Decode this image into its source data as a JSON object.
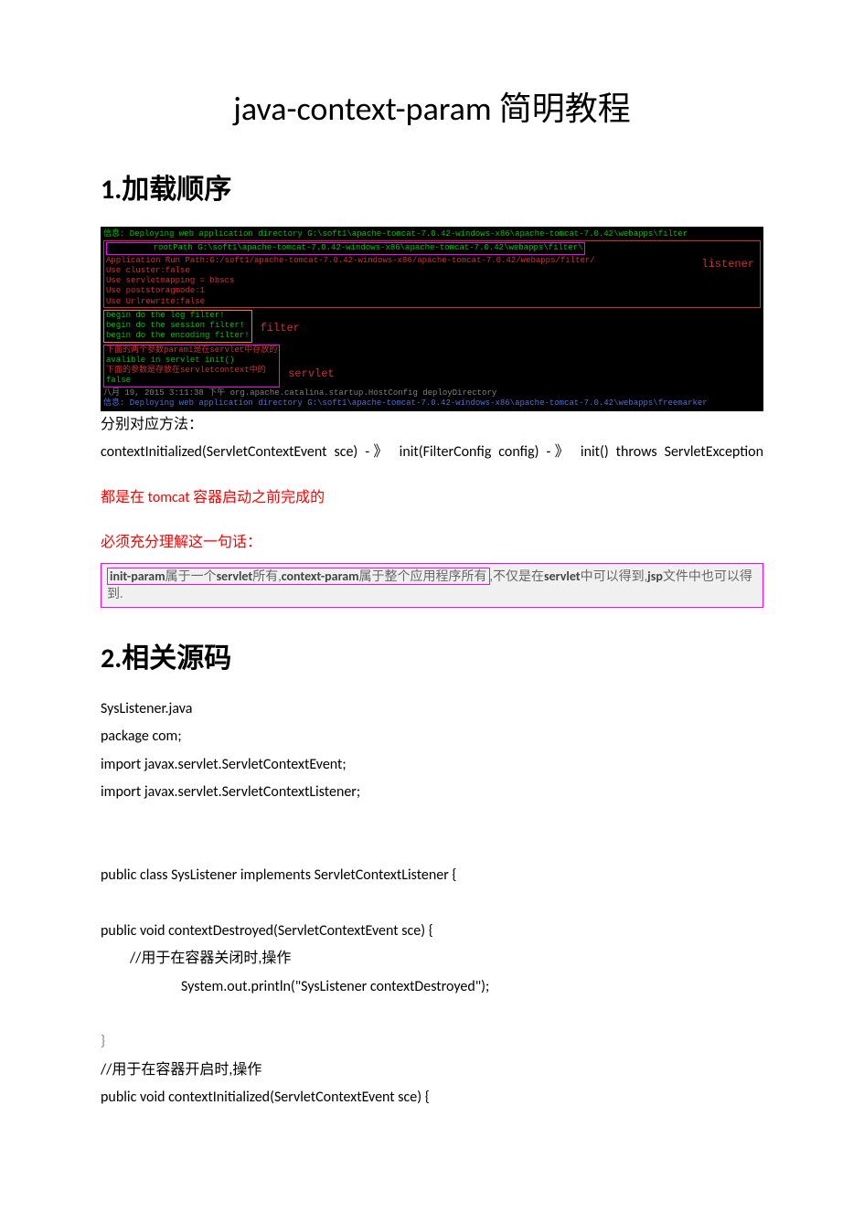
{
  "title": "java-context-param 简明教程",
  "section1": {
    "heading": "1.加载顺序",
    "console": {
      "line_deploy1": "信息: Deploying web application directory G:\\soft1\\apache-tomcat-7.0.42-windows-x86\\apache-tomcat-7.0.42\\webapps\\filter",
      "listener": {
        "l1": "         rootPath G:\\soft1\\apache-tomcat-7.0.42-windows-x86\\apache-tomcat-7.0.42\\webapps\\filter\\",
        "l2": "Application Run Path:G:/soft1/apache-tomcat-7.0.42-windows-x86/apache-tomcat-7.0.42/webapps/filter/",
        "l3": "Use cluster:false",
        "l4": "Use servletmapping = bbscs",
        "l5": "Use poststoragmode:1",
        "l6": "Use Urlrewrite:false",
        "label": "listener"
      },
      "filter": {
        "f1": "begin do the log filter!",
        "f2": "begin do the session filter!",
        "f3": "begin do the encoding filter!",
        "label": "filter"
      },
      "servlet": {
        "s1": "下面的两个参数param1是在servlet中存放的",
        "s2": "avalible in servlet init()",
        "s3": "下面的参数是存放在servletcontext中的",
        "s4": "false",
        "label": "servlet"
      },
      "footer1": "八月 19, 2015 3:11:38 下午 org.apache.catalina.startup.HostConfig deployDirectory",
      "footer2": "信息: Deploying web application directory G:\\soft1\\apache-tomcat-7.0.42-windows-x86\\apache-tomcat-7.0.42\\webapps\\freemarker"
    },
    "after": "分别对应方法：",
    "chain": "contextInitialized(ServletContextEvent sce) -》 init(FilterConfig config) -》 init() throws ServletException",
    "red1": "都是在 tomcat 容器启动之前完成的",
    "red2": "必须充分理解这一句话：",
    "quote_inner": "init-param属于一个servlet所有,context-param属于整个应用程序所有",
    "quote_rest": ",不仅是在servlet中可以得到,jsp文件中也可以得到."
  },
  "section2": {
    "heading": "2.相关源码",
    "code": {
      "l01": "SysListener.java",
      "l02": "package com;",
      "l03": "import javax.servlet.ServletContextEvent;",
      "l04": "import javax.servlet.ServletContextListener;",
      "l05": "public class SysListener   implements ServletContextListener {",
      "l06": "public void contextDestroyed(ServletContextEvent sce) {",
      "l07": "//用于在容器关闭时,操作",
      "l08": "System.out.println(\"SysListener contextDestroyed\");",
      "l09": "}",
      "l10": "//用于在容器开启时,操作",
      "l11": "public void contextInitialized(ServletContextEvent sce) {"
    }
  }
}
